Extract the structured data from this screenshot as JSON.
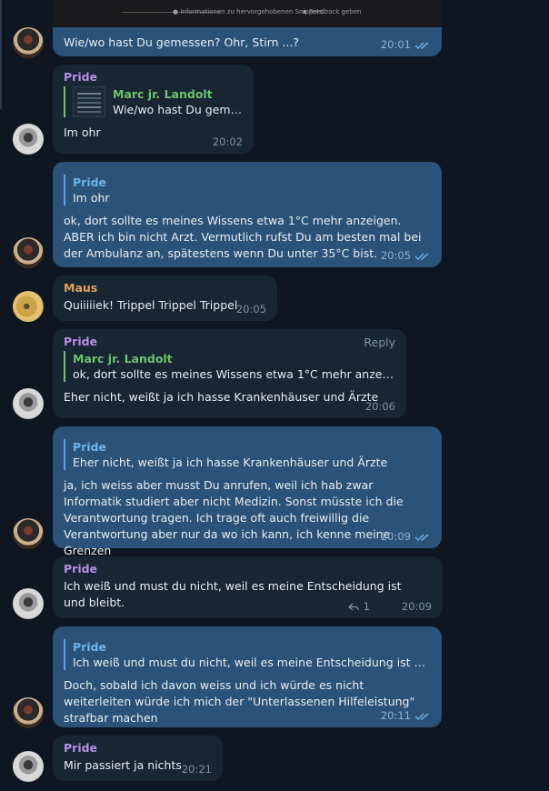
{
  "top_card": {
    "info_label": "Informationen zu hervorgehobenen Snippets",
    "feedback_label": "Feedback geben"
  },
  "messages": [
    {
      "id": "m1",
      "sender": "",
      "text": "Wie/wo hast Du gemessen? Ohr, Stirn ...?",
      "time": "20:01"
    },
    {
      "id": "m2",
      "sender": "Pride",
      "quote_name": "Marc jr. Landolt",
      "quote_text": "Wie/wo hast Du geme...",
      "text": "Im ohr",
      "time": "20:02"
    },
    {
      "id": "m3",
      "quote_name": "Pride",
      "quote_text": "Im ohr",
      "text": "ok, dort sollte es meines Wissens etwa 1°C mehr anzeigen. ABER ich bin nicht Arzt. Vermutlich rufst Du am besten mal bei der Ambulanz an, spätestens wenn Du unter 35°C bist.",
      "time": "20:05"
    },
    {
      "id": "m4",
      "sender": "Maus",
      "text": "Quiiiiiek! Trippel Trippel Trippel",
      "time": "20:05"
    },
    {
      "id": "m5",
      "sender": "Pride",
      "reply_label": "Reply",
      "quote_name": "Marc jr. Landolt",
      "quote_text": "ok, dort sollte es meines Wissens etwa 1°C mehr anzeigen....",
      "text": "Eher nicht, weißt ja ich hasse Krankenhäuser und Ärzte",
      "time": "20:06"
    },
    {
      "id": "m6",
      "quote_name": "Pride",
      "quote_text": "Eher nicht, weißt ja ich hasse Krankenhäuser und Ärzte",
      "text": "ja, ich weiss aber musst Du anrufen, weil ich hab zwar Informatik studiert aber nicht Medizin. Sonst müsste ich die Verantwortung tragen. Ich trage oft auch freiwillig die Verantwortung aber nur da wo ich kann, ich kenne meine Grenzen",
      "time": "20:09"
    },
    {
      "id": "m7",
      "sender": "Pride",
      "text": "Ich weiß und must du nicht, weil es meine Entscheidung ist und bleibt.",
      "replies": "1",
      "time": "20:09"
    },
    {
      "id": "m8",
      "quote_name": "Pride",
      "quote_text": "Ich weiß und must du nicht, weil es meine Entscheidung ist und ...",
      "text": "Doch, sobald ich davon weiss und ich würde es nicht weiterleiten würde ich mich der \"Unterlassenen Hilfeleistung\" strafbar machen",
      "time": "20:11"
    },
    {
      "id": "m9",
      "sender": "Pride",
      "text": "Mir passiert ja nichts",
      "time": "20:21"
    }
  ],
  "colors": {
    "background": "#0e1621",
    "incoming_bubble": "#182533",
    "outgoing_bubble": "#2b5278",
    "pride_name": "#b88ee6",
    "maus_name": "#e6a15c",
    "quote_green": "#6cc46c",
    "quote_blue": "#6fb4ea"
  },
  "icons": {
    "read_ticks": "double-check-icon",
    "reply_arrow": "reply-arrow-icon"
  }
}
